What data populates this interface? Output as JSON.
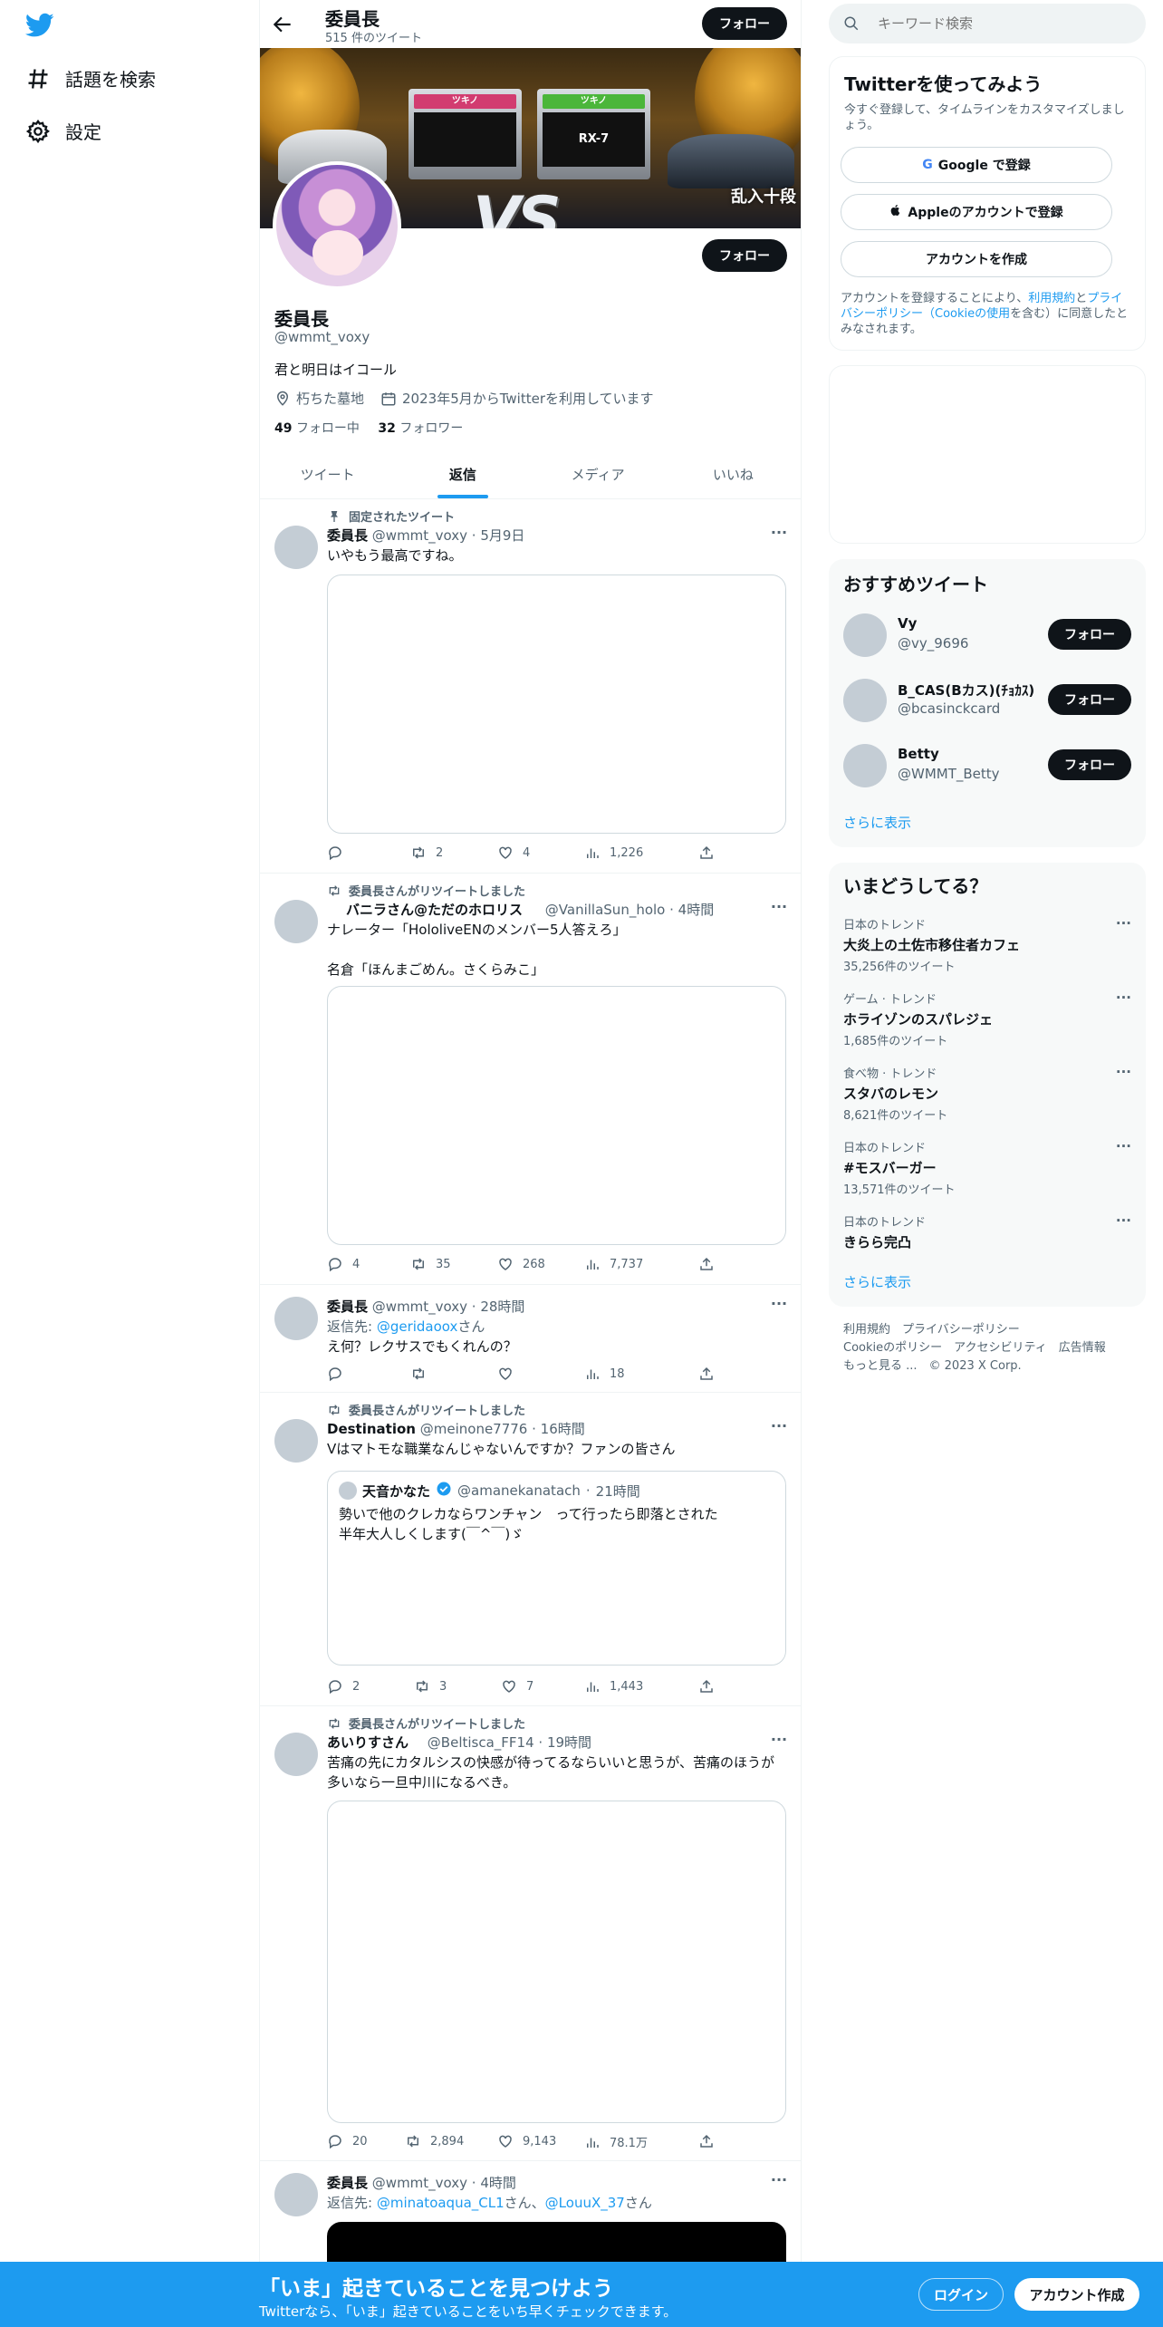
{
  "nav": {
    "items": [
      {
        "label": "話題を検索",
        "icon": "hashtag-icon"
      },
      {
        "label": "設定",
        "icon": "gear-icon"
      }
    ]
  },
  "header": {
    "title": "委員長",
    "subtitle": "515 件のツイート",
    "follow_label": "フォロー"
  },
  "banner": {
    "card1_title": "ツキノ",
    "card2_title": "ツキノ",
    "card2_car": "RX-7",
    "vs": "VS",
    "tag": "乱入十段"
  },
  "profile": {
    "follow_label": "フォロー",
    "name": "委員長",
    "handle": "@wmmt_voxy",
    "bio": "君と明日はイコール",
    "location": "朽ちた墓地",
    "joined": "2023年5月からTwitterを利用しています",
    "following_count": "49",
    "following_label": "フォロー中",
    "followers_count": "32",
    "followers_label": "フォロワー"
  },
  "tabs": [
    "ツイート",
    "返信",
    "メディア",
    "いいね"
  ],
  "active_tab": "返信",
  "tweets": [
    {
      "context": "固定されたツイート",
      "name": "委員長",
      "handle": "@wmmt_voxy",
      "time": "5月9日",
      "text": "いやもう最高ですね。",
      "reply": "",
      "retweet": "2",
      "like": "4",
      "views": "1,226"
    },
    {
      "context": "委員長さんがリツイートしました",
      "name": "バニラさん@ただのホロリス",
      "handle": "@VanillaSun_holo",
      "time": "4時間",
      "text": "ナレーター「HololiveENのメンバー5人答えろ」\n\n名倉「ほんまごめん。さくらみこ」",
      "reply": "4",
      "retweet": "35",
      "like": "268",
      "views": "7,737"
    },
    {
      "name": "委員長",
      "handle": "@wmmt_voxy",
      "time": "28時間",
      "reply_to_prefix": "返信先: ",
      "reply_to_handle": "@geridaoox",
      "reply_to_suffix": "さん",
      "text": "え何？レクサスでもくれんの？",
      "views": "18"
    },
    {
      "context": "委員長さんがリツイートしました",
      "name": "Destination",
      "handle": "@meinone7776",
      "time": "16時間",
      "text": "Vはマトモな職業なんじゃないんですか？ファンの皆さん",
      "quote": {
        "name": "天音かなた",
        "handle": "@amanekanatach",
        "time": "21時間",
        "text": "勢いで他のクレカならワンチャン　って行ったら即落とされた\n半年大人しくします(￣^￣)ゞ"
      },
      "reply": "2",
      "retweet": "3",
      "like": "7",
      "views": "1,443"
    },
    {
      "context": "委員長さんがリツイートしました",
      "name": "あいりすさん",
      "handle": "@Beltisca_FF14",
      "time": "19時間",
      "text": "苦痛の先にカタルシスの快感が待ってるならいいと思うが、苦痛のほうが\n多いなら一旦中川になるべき。",
      "reply": "20",
      "retweet": "2,894",
      "like": "9,143",
      "views": "78.1万"
    },
    {
      "name": "委員長",
      "handle": "@wmmt_voxy",
      "time": "4時間",
      "reply_to_prefix": "返信先: ",
      "reply_to_handle": "@minatoaqua_CL1",
      "reply_to_mid": "さん、",
      "reply_to_handle2": "@LouuX_37",
      "reply_to_suffix": "さん"
    }
  ],
  "search": {
    "placeholder": "キーワード検索"
  },
  "signup": {
    "title": "Twitterを使ってみよう",
    "subtitle": "今すぐ登録して、タイムラインをカスタマイズしましょう。",
    "google_label": "Google で登録",
    "apple_label": "Appleのアカウントで登録",
    "create_label": "アカウントを作成",
    "legal_prefix": "アカウントを登録することにより、",
    "legal_terms": "利用規約",
    "legal_and": "と",
    "legal_privacy": "プライバシーポリシー",
    "legal_cookie": "（Cookieの使用",
    "legal_suffix": "を含む）に同意したとみなされます。"
  },
  "recommended": {
    "title": "おすすめツイート",
    "users": [
      {
        "name": "Vy",
        "handle": "@vy_9696",
        "follow": "フォロー"
      },
      {
        "name": "B_CAS(Bカス)(ﾁｮｶｽ)",
        "handle": "@bcasinckcard",
        "follow": "フォロー"
      },
      {
        "name": "Betty",
        "handle": "@WMMT_Betty",
        "follow": "フォロー"
      }
    ],
    "more": "さらに表示"
  },
  "trends": {
    "title": "いまどうしてる？",
    "items": [
      {
        "category": "日本のトレンド",
        "name": "大炎上の土佐市移住者カフェ",
        "count": "35,256件のツイート"
      },
      {
        "category": "ゲーム · トレンド",
        "name": "ホライゾンのスパレジェ",
        "count": "1,685件のツイート"
      },
      {
        "category": "食べ物 · トレンド",
        "name": "スタバのレモン",
        "count": "8,621件のツイート"
      },
      {
        "category": "日本のトレンド",
        "name": "#モスバーガー",
        "count": "13,571件のツイート"
      },
      {
        "category": "日本のトレンド",
        "name": "きらら完凸",
        "count": ""
      }
    ],
    "more": "さらに表示"
  },
  "footer": {
    "line1": "利用規約　プライバシーポリシー",
    "line2": "Cookieのポリシー　アクセシビリティ　広告情報",
    "line3": "もっと見る ...　© 2023 X Corp."
  },
  "bottom": {
    "title": "「いま」起きていることを見つけよう",
    "subtitle": "Twitterなら、「いま」起きていることをいち早くチェックできます。",
    "login": "ログイン",
    "create": "アカウント作成"
  },
  "colors": {
    "accent": "#1d9bf0",
    "text": "#0f1419",
    "muted": "#536471"
  }
}
